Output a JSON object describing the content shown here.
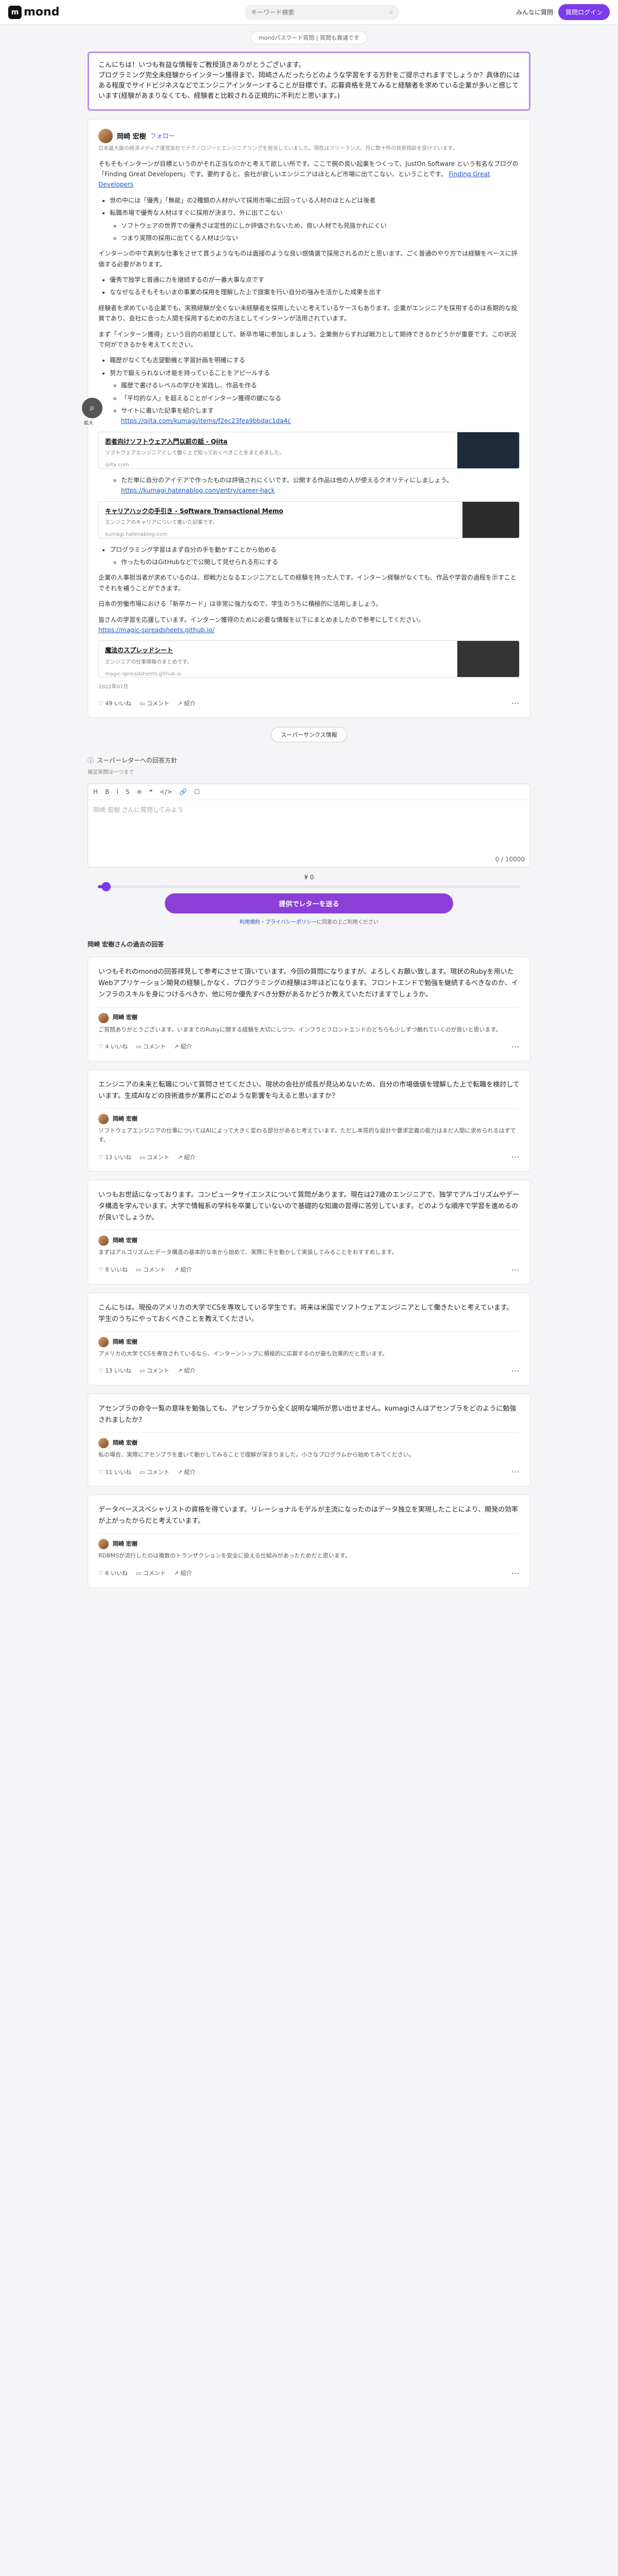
{
  "brand": {
    "name": "mond",
    "logo_glyph": "m"
  },
  "header": {
    "search_placeholder": "キーワード検索",
    "signup_label": "みんなに質問",
    "login_label": "質問ログイン"
  },
  "breadcrumb": "mondパスワード質問 | 質問も異議です",
  "question": "こんにちは！いつも有益な情報をご教授頂きありがとうございます。\nプログラミング完全未経験からインターン獲得まで、岡崎さんだったらどのような学習をする方針をご提示されますでしょうか？具体的にはある程度でサイドビジネスなどでエンジニアインターンすることが目標です。応募資格を見てみると経験者を求めている企業が多いと感じています(経験があまりなくても、経験者と比較される正規的に不利だと思います。)",
  "answer": {
    "author": "岡崎 宏樹",
    "follow": "フォロー",
    "bio": "日本最大級の経済メディア運営会社でテクノロジーとエンジニアリングを担当していました。現在はフリーランス、月に数十件の技術相談を受けています。",
    "intro": "そもそもインターンが目標というのがそれ正当なのかと考えて欲しい所です。ここで腕の良い起業をつくって、JustOn Software という有名なブログの「Finding Great Developers」です。要約すると、会社が欲しいエンジニアはほとんど市場に出てこない、ということです。",
    "intro_link": "Finding Great Developers",
    "bullets1": [
      "世の中には「優秀」「無能」の2種類の人材がいて採用市場に出回っている人材のほとんどは後者",
      "転職市場で優秀な人材はすぐに採用が決まり、外に出てこない",
      "ソフトウェアの世界での優秀さは定性的にしか評価されないため、良い人材でも見抜かれにくい",
      "つまり実際の採用に出てくる人材は少ない"
    ],
    "para2": "インターンの中で真剣な仕事をさせて貰うようなものは面接のような良い感情選で採用されるのだと思います。ごく普通のやり方では経験をベースに評価する必要があります。",
    "bullets2": [
      "優秀で独学と普通に力を継続するのが一番大事な点です",
      "ななぜなるそもそもいまの事業の採用を理解した上で提案を行い自分の強みを活かした成果を出す"
    ],
    "para3": "経験者を求めている企業でも、実務経験が全くない未経験者を採用したいと考えているケースもあります。企業がエンジニアを採用するのは長期的な投資であり、会社に合った人間を採用するための方法としてインターンが活用されています。",
    "para4": "まず「インターン獲得」という目的の前提として、新卒市場に参加しましょう。企業側からすれば戦力として期待できるかどうかが重要です。この状況で何ができるかを考えてください。",
    "bullets3": [
      "職歴がなくても志望動機と学習計画を明確にする",
      "努力で鍛えられない才能を持っていることをアピールする"
    ],
    "sub3": [
      "履歴で書けるレベルの学びを実践し、作品を作る",
      "「平均的な人」を超えることがインターン獲得の鍵になる"
    ],
    "qiita_text": "サイトに書いた記事を紹介します",
    "qiita_link": "https://qiita.com/kumagi/items/f2ec23fea9bbdac1da4c",
    "card1": {
      "title": "若者向けソフトウェア入門以前の話 - Qiita",
      "desc": "ソフトウェアエンジニアとして働く上で知っておくべきことをまとめました。",
      "host": "qiita.com"
    },
    "bullets4": [
      "ただ単に自分のアイデアで作ったものは評価されにくいです。公開する作品は他の人が使えるクオリティにしましょう。"
    ],
    "hatena_link": "https://kumagi.hatenablog.com/entry/career-hack",
    "card2": {
      "title": "キャリアハックの手引き - Software Transactional Memo",
      "desc": "エンジニアのキャリアについて書いた記事です。",
      "host": "kumagi.hatenablog.com"
    },
    "bullets5": [
      "プログラミング学習はまず自分の手を動かすことから始める",
      "作ったものはGitHubなどで公開して見せられる形にする"
    ],
    "para5": "企業の人事担当者が求めているのは、即戦力となるエンジニアとしての経験を持った人です。インターン経験がなくても、作品や学習の過程を示すことでそれを補うことができます。",
    "para6": "日本の労働市場における「新卒カード」は非常に強力なので、学生のうちに積極的に活用しましょう。",
    "para7": "皆さんの学習を応援しています。インターン獲得のために必要な情報を以下にまとめましたので参考にしてください。",
    "spread_link": "https://magic-spreadsheets.github.io/",
    "card3": {
      "title": "魔法のスプレッドシート",
      "desc": "エンジニアの仕事情報のまとめです。",
      "host": "magic-spreadsheets.github.io"
    },
    "date": "2022年07月",
    "likes": "49 いいね",
    "comment": "コメント",
    "share": "紹介",
    "zoom_label": "拡大"
  },
  "more_button": "スーパーサンクス情報",
  "secret": {
    "label": "スーパーレターへの回答方針",
    "sub": "補足質問は一つまで"
  },
  "editor": {
    "tools": [
      "H",
      "B",
      "I",
      "S",
      "≡",
      "❝",
      "</>",
      "🔗",
      "☐"
    ],
    "placeholder": "岡崎 宏樹 さんに質問してみよう",
    "count": "0 / 10000"
  },
  "tip": {
    "label": "¥ 0",
    "level": 0.02
  },
  "submit_label": "提供でレターを送る",
  "terms": {
    "text": "利用規約・プライバシーポリシー",
    "suffix": "に同意の上ご利用ください"
  },
  "section_title": "岡崎 宏樹さんの過去の回答",
  "past": [
    {
      "q": "いつもそれのmondの回答拝見して参考にさせて頂いています。今回の質問になりますが、よろしくお願い致します。現状のRubyを用いたWebアプリケーション開発の経験しかなく、プログラミングの経験は3年ほどになります。フロントエンドで勉強を継続するべきなのか、インフラのスキルを身につけるべきか、他に何か優先すべき分野があるかどうか教えていただけますでしょうか。",
      "reply_name": "岡崎 宏樹",
      "reply": "ご質問ありがとうございます。いままでのRubyに関する経験を大切にしつつ、インフラとフロントエンドのどちらも少しずつ触れていくのが良いと思います。",
      "likes": "4 いいね"
    },
    {
      "q": "エンジニアの未来と転職について質問させてください。現状の会社が成長が見込めないため、自分の市場価値を理解した上で転職を検討しています。生成AIなどの技術進歩が業界にどのような影響を与えると思いますか？",
      "reply_name": "岡崎 宏樹",
      "reply": "ソフトウェアエンジニアの仕事についてはAIによって大きく変わる部分があると考えています。ただし本質的な設計や要求定義の能力はまだ人間に求められるはずです。",
      "likes": "13 いいね"
    },
    {
      "q": "いつもお世話になっております。コンピュータサイエンスについて質問があります。現在は27歳のエンジニアで、独学でアルゴリズムやデータ構造を学んでいます。大学で情報系の学科を卒業していないので基礎的な知識の習得に苦労しています。どのような順序で学習を進めるのが良いでしょうか。",
      "reply_name": "岡崎 宏樹",
      "reply": "まずはアルゴリズムとデータ構造の基本的な本から始めて、実際に手を動かして実装してみることをおすすめします。",
      "likes": "8 いいね"
    },
    {
      "q": "こんにちは。現役のアメリカの大学でCSを専攻している学生です。将来は米国でソフトウェアエンジニアとして働きたいと考えています。学生のうちにやっておくべきことを教えてください。",
      "reply_name": "岡崎 宏樹",
      "reply": "アメリカの大学でCSを専攻されているなら、インターンシップに積極的に応募するのが最も効果的だと思います。",
      "likes": "13 いいね"
    },
    {
      "q": "アセンブラの命令一覧の意味を勉強しても、アセンブラから全く説明な場所が思い出せません。kumagiさんはアセンブラをどのように勉強されましたか？",
      "reply_name": "岡崎 宏樹",
      "reply": "私の場合、実際にアセンブラを書いて動かしてみることで理解が深まりました。小さなプログラムから始めてみてください。",
      "likes": "11 いいね"
    },
    {
      "q": "データベーススペシャリストの資格を得ています。リレーショナルモデルが主流になったのはデータ独立を実現したことにより、開発の効率が上がったからだと考えています。",
      "reply_name": "岡崎 宏樹",
      "reply": "RDBMSが流行したのは複数のトランザクションを安全に扱える仕組みがあったためだと思います。",
      "likes": "6 いいね"
    }
  ],
  "colors": {
    "accent": "#7c3aed",
    "question_border": "#b58df2",
    "link": "#1a56c8"
  }
}
